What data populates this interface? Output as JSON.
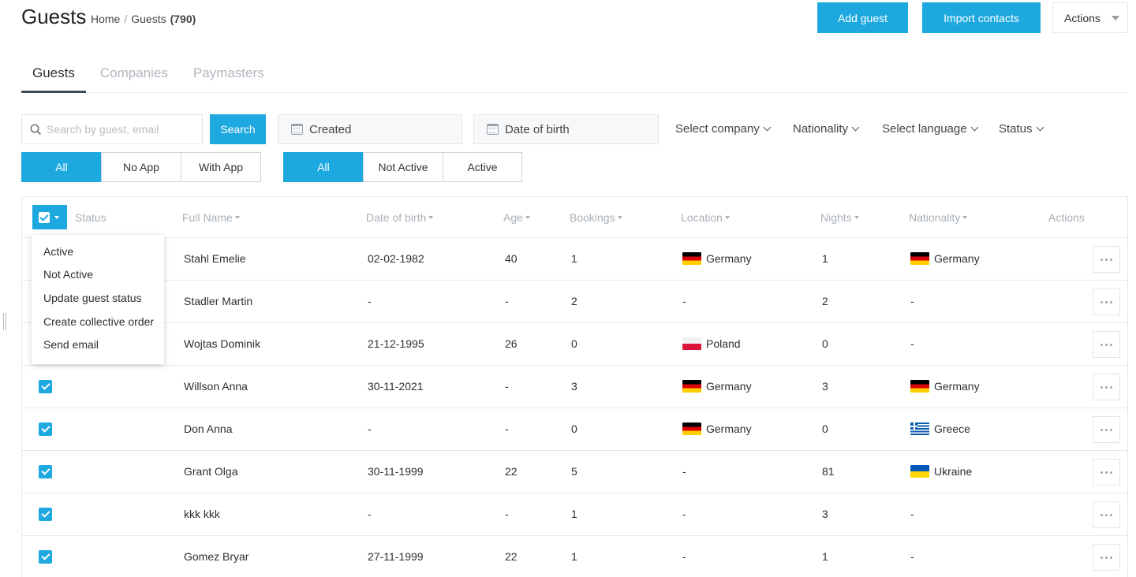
{
  "header": {
    "title": "Guests",
    "breadcrumb": {
      "home": "Home",
      "separator": "/",
      "current": "Guests",
      "count": "(790)"
    },
    "add_guest": "Add guest",
    "import_contacts": "Import contacts",
    "actions": "Actions"
  },
  "tabs": [
    {
      "label": "Guests",
      "active": true
    },
    {
      "label": "Companies",
      "active": false
    },
    {
      "label": "Paymasters",
      "active": false
    }
  ],
  "filters": {
    "search_placeholder": "Search by guest, email",
    "search_button": "Search",
    "created": "Created",
    "date_of_birth": "Date of birth",
    "select_company": "Select company",
    "nationality": "Nationality",
    "select_language": "Select language",
    "status": "Status",
    "app_filter": [
      "All",
      "No App",
      "With App"
    ],
    "status_filter": [
      "All",
      "Not Active",
      "Active"
    ]
  },
  "table": {
    "columns": {
      "status": "Status",
      "full_name": "Full Name",
      "date_of_birth": "Date of birth",
      "age": "Age",
      "bookings": "Bookings",
      "location": "Location",
      "nights": "Nights",
      "nationality": "Nationality",
      "actions": "Actions"
    },
    "rows": [
      {
        "name": "Stahl Emelie",
        "dob": "02-02-1982",
        "age": "40",
        "bookings": "1",
        "location": "Germany",
        "location_flag": "de",
        "nights": "1",
        "nationality": "Germany",
        "nationality_flag": "de"
      },
      {
        "name": "Stadler Martin",
        "dob": "-",
        "age": "-",
        "bookings": "2",
        "location": "-",
        "location_flag": "",
        "nights": "2",
        "nationality": "-",
        "nationality_flag": ""
      },
      {
        "name": "Wojtas Dominik",
        "dob": "21-12-1995",
        "age": "26",
        "bookings": "0",
        "location": "Poland",
        "location_flag": "pl",
        "nights": "0",
        "nationality": "-",
        "nationality_flag": ""
      },
      {
        "name": "Willson Anna",
        "dob": "30-11-2021",
        "age": "-",
        "bookings": "3",
        "location": "Germany",
        "location_flag": "de",
        "nights": "3",
        "nationality": "Germany",
        "nationality_flag": "de"
      },
      {
        "name": "Don Anna",
        "dob": "-",
        "age": "-",
        "bookings": "0",
        "location": "Germany",
        "location_flag": "de",
        "nights": "0",
        "nationality": "Greece",
        "nationality_flag": "gr"
      },
      {
        "name": "Grant Olga",
        "dob": "30-11-1999",
        "age": "22",
        "bookings": "5",
        "location": "-",
        "location_flag": "",
        "nights": "81",
        "nationality": "Ukraine",
        "nationality_flag": "ua"
      },
      {
        "name": "kkk kkk",
        "dob": "-",
        "age": "-",
        "bookings": "1",
        "location": "-",
        "location_flag": "",
        "nights": "3",
        "nationality": "-",
        "nationality_flag": ""
      },
      {
        "name": "Gomez Bryar",
        "dob": "27-11-1999",
        "age": "22",
        "bookings": "1",
        "location": "-",
        "location_flag": "",
        "nights": "1",
        "nationality": "-",
        "nationality_flag": ""
      }
    ]
  },
  "bulk_menu": [
    "Active",
    "Not Active",
    "Update guest status",
    "Create collective order",
    "Send email"
  ],
  "colors": {
    "accent": "#1ea8e0",
    "header_text": "#a9b0b7",
    "border": "#e6e9ec"
  }
}
